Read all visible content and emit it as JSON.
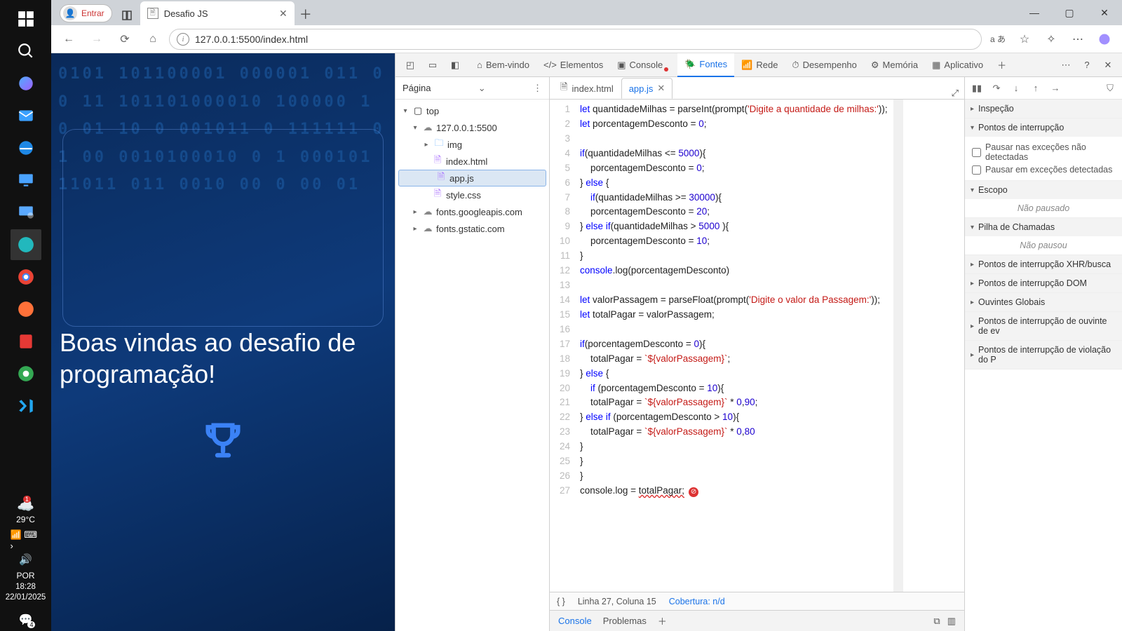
{
  "taskbar": {
    "lang": "POR",
    "time": "18:28",
    "date": "22/01/2025",
    "temp": "29°C",
    "weather_badge": "1"
  },
  "browser": {
    "signin": "Entrar",
    "tab_title": "Desafio JS",
    "url": "127.0.0.1:5500/index.html"
  },
  "page": {
    "headline": "Boas vindas ao desafio de programação!"
  },
  "devtools": {
    "tabs": {
      "welcome": "Bem-vindo",
      "elements": "Elementos",
      "console": "Console",
      "sources": "Fontes",
      "network": "Rede",
      "performance": "Desempenho",
      "memory": "Memória",
      "application": "Aplicativo"
    },
    "nav_header": "Página",
    "tree": {
      "top": "top",
      "host": "127.0.0.1:5500",
      "img": "img",
      "index": "index.html",
      "app": "app.js",
      "style": "style.css",
      "gapi": "fonts.googleapis.com",
      "gstatic": "fonts.gstatic.com"
    },
    "file_tabs": {
      "index": "index.html",
      "app": "app.js"
    },
    "code_lines": [
      "let quantidadeMilhas = parseInt(prompt('Digite a quantidade de milhas:'));",
      "let porcentagemDesconto = 0;",
      "",
      "if(quantidadeMilhas <= 5000){",
      "    porcentagemDesconto = 0;",
      "} else {",
      "    if(quantidadeMilhas >= 30000){",
      "    porcentagemDesconto = 20;",
      "} else if(quantidadeMilhas > 5000 ){",
      "    porcentagemDesconto = 10;",
      "}",
      "console.log(porcentagemDesconto)",
      "",
      "let valorPassagem = parseFloat(prompt('Digite o valor da Passagem:'));",
      "let totalPagar = valorPassagem;",
      "",
      "if(porcentagemDesconto = 0){",
      "    totalPagar = `${valorPassagem}`;",
      "} else {",
      "    if (porcentagemDesconto = 10){",
      "    totalPagar = `${valorPassagem}` * 0,90;",
      "} else if (porcentagemDesconto > 10){",
      "    totalPagar = `${valorPassagem}` * 0,80",
      "}",
      "}",
      "}",
      "console.log = totalPagar;"
    ],
    "status": {
      "cursor": "Linha 27, Coluna 15",
      "coverage": "Cobertura: n/d"
    },
    "drawer": {
      "console": "Console",
      "problems": "Problemas"
    },
    "dbg": {
      "inspect": "Inspeção",
      "breakpoints": "Pontos de interrupção",
      "pause_uncaught": "Pausar nas exceções não detectadas",
      "pause_caught": "Pausar em exceções detectadas",
      "scope": "Escopo",
      "not_paused": "Não pausado",
      "callstack": "Pilha de Chamadas",
      "not_paused2": "Não pausou",
      "xhr": "Pontos de interrupção XHR/busca",
      "dom": "Pontos de interrupção DOM",
      "global": "Ouvintes Globais",
      "event": "Pontos de interrupção de ouvinte de ev",
      "csp": "Pontos de interrupção de violação do P"
    }
  }
}
